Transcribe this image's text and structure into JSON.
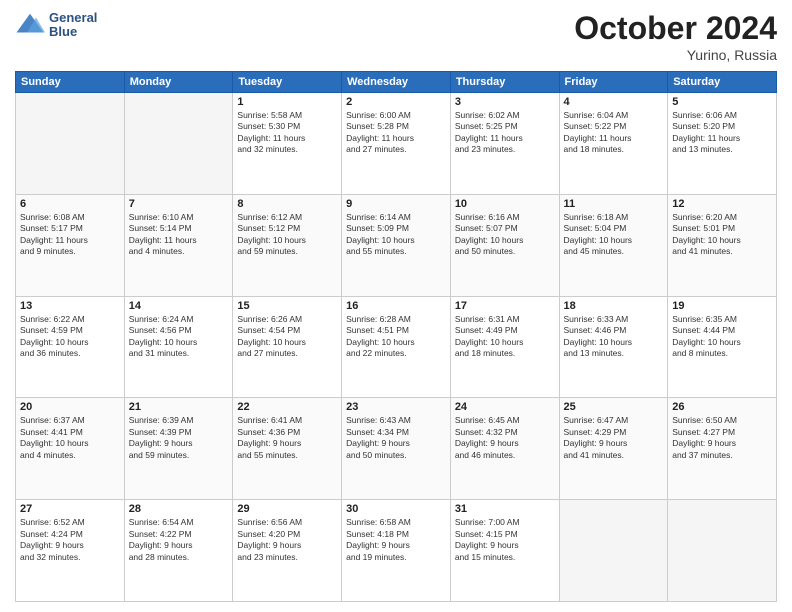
{
  "header": {
    "logo_line1": "General",
    "logo_line2": "Blue",
    "month_title": "October 2024",
    "location": "Yurino, Russia"
  },
  "weekdays": [
    "Sunday",
    "Monday",
    "Tuesday",
    "Wednesday",
    "Thursday",
    "Friday",
    "Saturday"
  ],
  "weeks": [
    [
      {
        "day": "",
        "info": ""
      },
      {
        "day": "",
        "info": ""
      },
      {
        "day": "1",
        "info": "Sunrise: 5:58 AM\nSunset: 5:30 PM\nDaylight: 11 hours\nand 32 minutes."
      },
      {
        "day": "2",
        "info": "Sunrise: 6:00 AM\nSunset: 5:28 PM\nDaylight: 11 hours\nand 27 minutes."
      },
      {
        "day": "3",
        "info": "Sunrise: 6:02 AM\nSunset: 5:25 PM\nDaylight: 11 hours\nand 23 minutes."
      },
      {
        "day": "4",
        "info": "Sunrise: 6:04 AM\nSunset: 5:22 PM\nDaylight: 11 hours\nand 18 minutes."
      },
      {
        "day": "5",
        "info": "Sunrise: 6:06 AM\nSunset: 5:20 PM\nDaylight: 11 hours\nand 13 minutes."
      }
    ],
    [
      {
        "day": "6",
        "info": "Sunrise: 6:08 AM\nSunset: 5:17 PM\nDaylight: 11 hours\nand 9 minutes."
      },
      {
        "day": "7",
        "info": "Sunrise: 6:10 AM\nSunset: 5:14 PM\nDaylight: 11 hours\nand 4 minutes."
      },
      {
        "day": "8",
        "info": "Sunrise: 6:12 AM\nSunset: 5:12 PM\nDaylight: 10 hours\nand 59 minutes."
      },
      {
        "day": "9",
        "info": "Sunrise: 6:14 AM\nSunset: 5:09 PM\nDaylight: 10 hours\nand 55 minutes."
      },
      {
        "day": "10",
        "info": "Sunrise: 6:16 AM\nSunset: 5:07 PM\nDaylight: 10 hours\nand 50 minutes."
      },
      {
        "day": "11",
        "info": "Sunrise: 6:18 AM\nSunset: 5:04 PM\nDaylight: 10 hours\nand 45 minutes."
      },
      {
        "day": "12",
        "info": "Sunrise: 6:20 AM\nSunset: 5:01 PM\nDaylight: 10 hours\nand 41 minutes."
      }
    ],
    [
      {
        "day": "13",
        "info": "Sunrise: 6:22 AM\nSunset: 4:59 PM\nDaylight: 10 hours\nand 36 minutes."
      },
      {
        "day": "14",
        "info": "Sunrise: 6:24 AM\nSunset: 4:56 PM\nDaylight: 10 hours\nand 31 minutes."
      },
      {
        "day": "15",
        "info": "Sunrise: 6:26 AM\nSunset: 4:54 PM\nDaylight: 10 hours\nand 27 minutes."
      },
      {
        "day": "16",
        "info": "Sunrise: 6:28 AM\nSunset: 4:51 PM\nDaylight: 10 hours\nand 22 minutes."
      },
      {
        "day": "17",
        "info": "Sunrise: 6:31 AM\nSunset: 4:49 PM\nDaylight: 10 hours\nand 18 minutes."
      },
      {
        "day": "18",
        "info": "Sunrise: 6:33 AM\nSunset: 4:46 PM\nDaylight: 10 hours\nand 13 minutes."
      },
      {
        "day": "19",
        "info": "Sunrise: 6:35 AM\nSunset: 4:44 PM\nDaylight: 10 hours\nand 8 minutes."
      }
    ],
    [
      {
        "day": "20",
        "info": "Sunrise: 6:37 AM\nSunset: 4:41 PM\nDaylight: 10 hours\nand 4 minutes."
      },
      {
        "day": "21",
        "info": "Sunrise: 6:39 AM\nSunset: 4:39 PM\nDaylight: 9 hours\nand 59 minutes."
      },
      {
        "day": "22",
        "info": "Sunrise: 6:41 AM\nSunset: 4:36 PM\nDaylight: 9 hours\nand 55 minutes."
      },
      {
        "day": "23",
        "info": "Sunrise: 6:43 AM\nSunset: 4:34 PM\nDaylight: 9 hours\nand 50 minutes."
      },
      {
        "day": "24",
        "info": "Sunrise: 6:45 AM\nSunset: 4:32 PM\nDaylight: 9 hours\nand 46 minutes."
      },
      {
        "day": "25",
        "info": "Sunrise: 6:47 AM\nSunset: 4:29 PM\nDaylight: 9 hours\nand 41 minutes."
      },
      {
        "day": "26",
        "info": "Sunrise: 6:50 AM\nSunset: 4:27 PM\nDaylight: 9 hours\nand 37 minutes."
      }
    ],
    [
      {
        "day": "27",
        "info": "Sunrise: 6:52 AM\nSunset: 4:24 PM\nDaylight: 9 hours\nand 32 minutes."
      },
      {
        "day": "28",
        "info": "Sunrise: 6:54 AM\nSunset: 4:22 PM\nDaylight: 9 hours\nand 28 minutes."
      },
      {
        "day": "29",
        "info": "Sunrise: 6:56 AM\nSunset: 4:20 PM\nDaylight: 9 hours\nand 23 minutes."
      },
      {
        "day": "30",
        "info": "Sunrise: 6:58 AM\nSunset: 4:18 PM\nDaylight: 9 hours\nand 19 minutes."
      },
      {
        "day": "31",
        "info": "Sunrise: 7:00 AM\nSunset: 4:15 PM\nDaylight: 9 hours\nand 15 minutes."
      },
      {
        "day": "",
        "info": ""
      },
      {
        "day": "",
        "info": ""
      }
    ]
  ]
}
